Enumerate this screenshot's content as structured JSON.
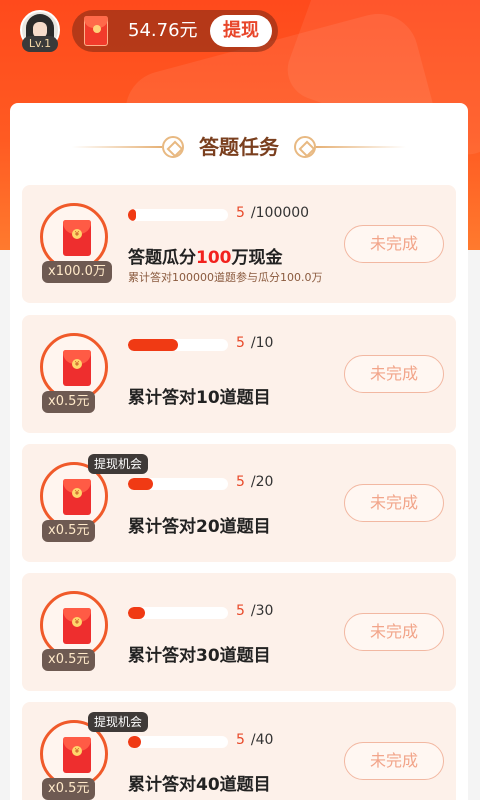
{
  "header": {
    "level": "Lv.1",
    "balance": "54.76元",
    "withdraw_label": "提现"
  },
  "panel": {
    "title": "答题任务"
  },
  "tasks": [
    {
      "reward": "x100.0万",
      "progress_current": "5",
      "progress_total": "/100000",
      "progress_fraction": 5e-05,
      "title_pre": "答题瓜分",
      "title_highlight": "100",
      "title_post": "万现金",
      "subtitle": "累计答对100000道题参与瓜分100.0万",
      "status": "未完成"
    },
    {
      "reward": "x0.5元",
      "progress_current": "5",
      "progress_total": "/10",
      "progress_fraction": 0.5,
      "title": "累计答对10道题目",
      "status": "未完成"
    },
    {
      "tag": "提现机会",
      "reward": "x0.5元",
      "progress_current": "5",
      "progress_total": "/20",
      "progress_fraction": 0.25,
      "title": "累计答对20道题目",
      "status": "未完成"
    },
    {
      "reward": "x0.5元",
      "progress_current": "5",
      "progress_total": "/30",
      "progress_fraction": 0.167,
      "title": "累计答对30道题目",
      "status": "未完成"
    },
    {
      "tag": "提现机会",
      "reward": "x0.5元",
      "progress_current": "5",
      "progress_total": "/40",
      "progress_fraction": 0.125,
      "title": "累计答对40道题目",
      "status": "未完成"
    }
  ],
  "colors": {
    "brand": "#ff4a1c",
    "progress_fill": "#f03a14",
    "highlight": "#f2221e"
  }
}
